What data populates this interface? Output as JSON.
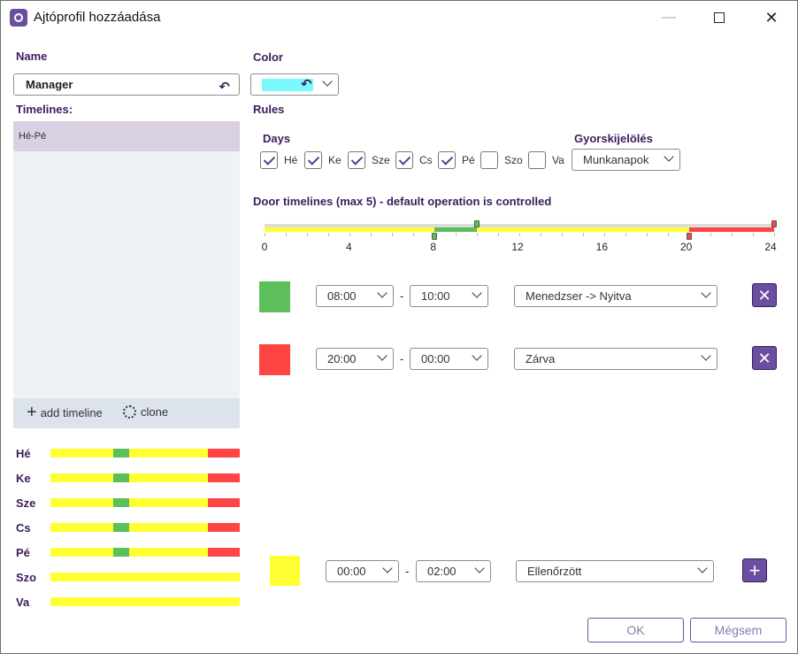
{
  "window": {
    "title": "Ajtóprofil hozzáadása",
    "minimize": "—",
    "close": "✕"
  },
  "name": {
    "label": "Name",
    "value": "Manager"
  },
  "color": {
    "label": "Color",
    "value": "#7cf8ff"
  },
  "timelines": {
    "label": "Timelines:",
    "items": [
      "Hé-Pé"
    ],
    "add_label": "add timeline",
    "clone_label": "clone"
  },
  "day_bars": [
    {
      "day": "Hé",
      "segments": [
        {
          "from": 0,
          "to": 8,
          "color": "#ffff33"
        },
        {
          "from": 8,
          "to": 10,
          "color": "#5cbf5c"
        },
        {
          "from": 10,
          "to": 20,
          "color": "#ffff33"
        },
        {
          "from": 20,
          "to": 24,
          "color": "#ff4444"
        }
      ]
    },
    {
      "day": "Ke",
      "segments": [
        {
          "from": 0,
          "to": 8,
          "color": "#ffff33"
        },
        {
          "from": 8,
          "to": 10,
          "color": "#5cbf5c"
        },
        {
          "from": 10,
          "to": 20,
          "color": "#ffff33"
        },
        {
          "from": 20,
          "to": 24,
          "color": "#ff4444"
        }
      ]
    },
    {
      "day": "Sze",
      "segments": [
        {
          "from": 0,
          "to": 8,
          "color": "#ffff33"
        },
        {
          "from": 8,
          "to": 10,
          "color": "#5cbf5c"
        },
        {
          "from": 10,
          "to": 20,
          "color": "#ffff33"
        },
        {
          "from": 20,
          "to": 24,
          "color": "#ff4444"
        }
      ]
    },
    {
      "day": "Cs",
      "segments": [
        {
          "from": 0,
          "to": 8,
          "color": "#ffff33"
        },
        {
          "from": 8,
          "to": 10,
          "color": "#5cbf5c"
        },
        {
          "from": 10,
          "to": 20,
          "color": "#ffff33"
        },
        {
          "from": 20,
          "to": 24,
          "color": "#ff4444"
        }
      ]
    },
    {
      "day": "Pé",
      "segments": [
        {
          "from": 0,
          "to": 8,
          "color": "#ffff33"
        },
        {
          "from": 8,
          "to": 10,
          "color": "#5cbf5c"
        },
        {
          "from": 10,
          "to": 20,
          "color": "#ffff33"
        },
        {
          "from": 20,
          "to": 24,
          "color": "#ff4444"
        }
      ]
    },
    {
      "day": "Szo",
      "segments": [
        {
          "from": 0,
          "to": 24,
          "color": "#ffff33"
        }
      ]
    },
    {
      "day": "Va",
      "segments": [
        {
          "from": 0,
          "to": 24,
          "color": "#ffff33"
        }
      ]
    }
  ],
  "rules": {
    "label": "Rules",
    "days_label": "Days",
    "days": [
      {
        "label": "Hé",
        "checked": true
      },
      {
        "label": "Ke",
        "checked": true
      },
      {
        "label": "Sze",
        "checked": true
      },
      {
        "label": "Cs",
        "checked": true
      },
      {
        "label": "Pé",
        "checked": true
      },
      {
        "label": "Szo",
        "checked": false
      },
      {
        "label": "Va",
        "checked": false
      }
    ],
    "quick_select": {
      "label": "Gyorskijelölés",
      "value": "Munkanapok"
    }
  },
  "door_timelines": {
    "label": "Door timelines (max 5) - default operation is controlled",
    "ticks": [
      0,
      4,
      8,
      12,
      16,
      20,
      24
    ],
    "segments": [
      {
        "from": 0,
        "to": 8,
        "color": "#ffff33"
      },
      {
        "from": 8,
        "to": 10,
        "color": "#5cbf5c"
      },
      {
        "from": 10,
        "to": 20,
        "color": "#ffff33"
      },
      {
        "from": 20,
        "to": 24,
        "color": "#ff4444"
      }
    ],
    "handles": [
      {
        "at": 8,
        "color": "#5cbf5c",
        "pos": "bottom"
      },
      {
        "at": 10,
        "color": "#5cbf5c",
        "pos": "top"
      },
      {
        "at": 20,
        "color": "#ff4444",
        "pos": "bottom"
      },
      {
        "at": 24,
        "color": "#ff4444",
        "pos": "top"
      }
    ]
  },
  "entries": [
    {
      "color": "#5cbf5c",
      "from": "08:00",
      "to": "10:00",
      "mode": "Menedzser -> Nyitva"
    },
    {
      "color": "#ff4444",
      "from": "20:00",
      "to": "00:00",
      "mode": "Zárva"
    }
  ],
  "new_entry": {
    "color": "#ffff33",
    "from": "00:00",
    "to": "02:00",
    "mode": "Ellenőrzött"
  },
  "dash": "-",
  "buttons": {
    "ok": "OK",
    "cancel": "Mégsem"
  }
}
